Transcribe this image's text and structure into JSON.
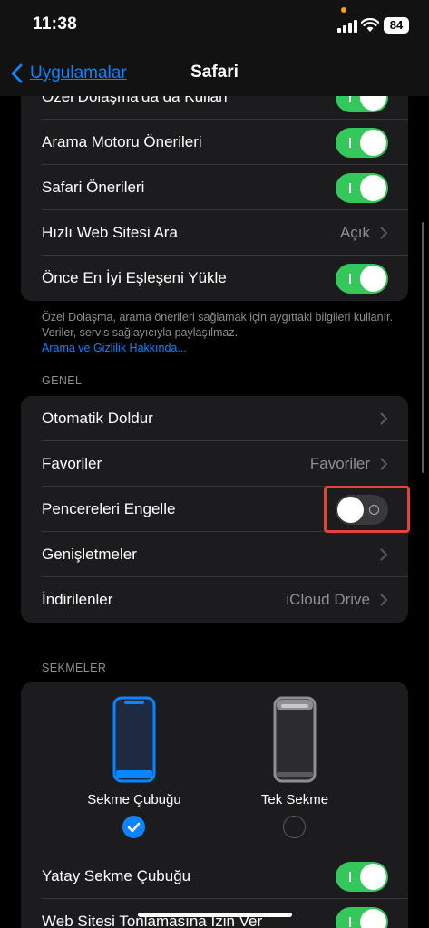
{
  "status_bar": {
    "time": "11:38",
    "battery": "84"
  },
  "nav": {
    "back_label": "Uygulamalar",
    "title": "Safari"
  },
  "search_group": {
    "rows": [
      {
        "label": "Özel Dolaşma'da da Kullan",
        "control": "toggle",
        "state": "on"
      },
      {
        "label": "Arama Motoru Önerileri",
        "control": "toggle",
        "state": "on"
      },
      {
        "label": "Safari Önerileri",
        "control": "toggle",
        "state": "on"
      },
      {
        "label": "Hızlı Web Sitesi Ara",
        "control": "disclosure",
        "value": "Açık"
      },
      {
        "label": "Önce En İyi Eşleşeni Yükle",
        "control": "toggle",
        "state": "on"
      }
    ],
    "footnote": "Özel Dolaşma, arama önerileri sağlamak için aygıttaki bilgileri kullanır. Veriler, servis sağlayıcıyla paylaşılmaz.",
    "footnote_link": "Arama ve Gizlilik Hakkında..."
  },
  "general": {
    "header": "GENEL",
    "rows": [
      {
        "label": "Otomatik Doldur",
        "control": "disclosure",
        "value": ""
      },
      {
        "label": "Favoriler",
        "control": "disclosure",
        "value": "Favoriler"
      },
      {
        "label": "Pencereleri Engelle",
        "control": "toggle",
        "state": "off"
      },
      {
        "label": "Genişletmeler",
        "control": "disclosure",
        "value": ""
      },
      {
        "label": "İndirilenler",
        "control": "disclosure",
        "value": "iCloud Drive"
      }
    ]
  },
  "tabs": {
    "header": "SEKMELER",
    "options": [
      {
        "label": "Sekme Çubuğu",
        "selected": true
      },
      {
        "label": "Tek Sekme",
        "selected": false
      }
    ],
    "rows": [
      {
        "label": "Yatay Sekme Çubuğu",
        "control": "toggle",
        "state": "on"
      },
      {
        "label": "Web Sitesi Tonlamasına İzin Ver",
        "control": "toggle",
        "state": "on"
      }
    ]
  },
  "colors": {
    "accent": "#0a84ff",
    "toggle_on": "#34c759",
    "highlight": "#e5433b"
  }
}
